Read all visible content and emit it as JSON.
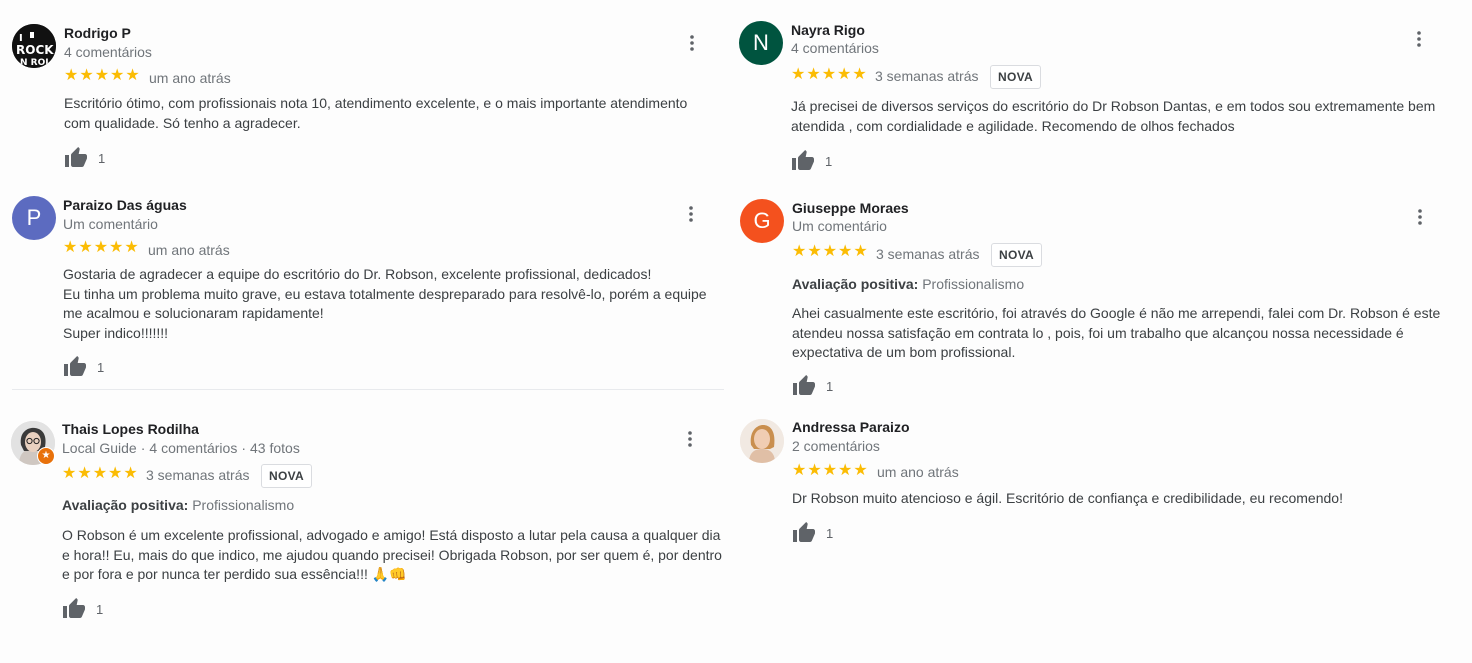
{
  "reviews": [
    {
      "name": "Rodrigo P",
      "meta": "4 comentários",
      "rating": 5,
      "time": "um ano atrás",
      "badge": "",
      "text": [
        "Escritório ótimo, com profissionais nota 10, atendimento excelente, e o mais importante atendimento com qualidade. Só tenho a agradecer."
      ],
      "likes": "1",
      "avatar": {
        "type": "logo",
        "letter": "",
        "color": "#111111"
      }
    },
    {
      "name": "Paraizo Das águas",
      "meta": "Um comentário",
      "rating": 5,
      "time": "um ano atrás",
      "badge": "",
      "text": [
        "Gostaria de agradecer a equipe do escritório do Dr. Robson, excelente profissional, dedicados!",
        "Eu tinha um problema muito grave, eu estava totalmente despreparado para resolvê-lo, porém a equipe me acalmou e solucionaram rapidamente!",
        "Super indico!!!!!!!"
      ],
      "likes": "1",
      "avatar": {
        "type": "letter",
        "letter": "P",
        "color": "#5c6bc0"
      }
    },
    {
      "name": "Thais Lopes Rodilha",
      "meta_parts": [
        "Local Guide",
        "4 comentários",
        "43 fotos"
      ],
      "rating": 5,
      "time": "3 semanas atrás",
      "badge": "NOVA",
      "highlight_label": "Avaliação positiva:",
      "highlight_value": "Profissionalismo",
      "text": [
        "O Robson é um excelente profissional, advogado e amigo! Está disposto a lutar pela causa a qualquer dia e hora!! Eu, mais do que indico, me ajudou quando precisei! Obrigada Robson, por ser quem é, por dentro e por fora e por nunca ter perdido sua essência!!! 🙏👊"
      ],
      "likes": "1",
      "avatar": {
        "type": "photo",
        "letter": "",
        "color": "#cfcfcf"
      }
    },
    {
      "name": "Nayra Rigo",
      "meta": "4 comentários",
      "rating": 5,
      "time": "3 semanas atrás",
      "badge": "NOVA",
      "text": [
        "Já precisei de diversos serviços do escritório do Dr Robson Dantas, e em todos sou extremamente bem atendida , com cordialidade e agilidade. Recomendo de olhos fechados"
      ],
      "likes": "1",
      "avatar": {
        "type": "letter",
        "letter": "N",
        "color": "#00543f"
      }
    },
    {
      "name": "Giuseppe Moraes",
      "meta": "Um comentário",
      "rating": 5,
      "time": "3 semanas atrás",
      "badge": "NOVA",
      "highlight_label": "Avaliação positiva:",
      "highlight_value": "Profissionalismo",
      "text": [
        "Ahei casualmente este escritório, foi através do Google é não me arrependi, falei com Dr. Robson  é este atendeu nossa satisfação em contrata lo , pois, foi um trabalho que alcançou nossa necessidade é expectativa de um bom profissional."
      ],
      "likes": "1",
      "avatar": {
        "type": "letter",
        "letter": "G",
        "color": "#f4511e"
      }
    },
    {
      "name": "Andressa Paraizo",
      "meta": "2 comentários",
      "rating": 5,
      "time": "um ano atrás",
      "badge": "",
      "text": [
        "Dr Robson muito atencioso e ágil. Escritório de confiança e credibilidade, eu recomendo!"
      ],
      "likes": "1",
      "avatar": {
        "type": "photo",
        "letter": "",
        "color": "#e7c9b2"
      }
    }
  ],
  "colors": {
    "star": "#fbbc04",
    "text": "#3c4043",
    "muted": "#70757a"
  },
  "icons": {
    "like": "thumbs-up-icon",
    "more": "more-vert-icon",
    "star": "star-icon"
  }
}
